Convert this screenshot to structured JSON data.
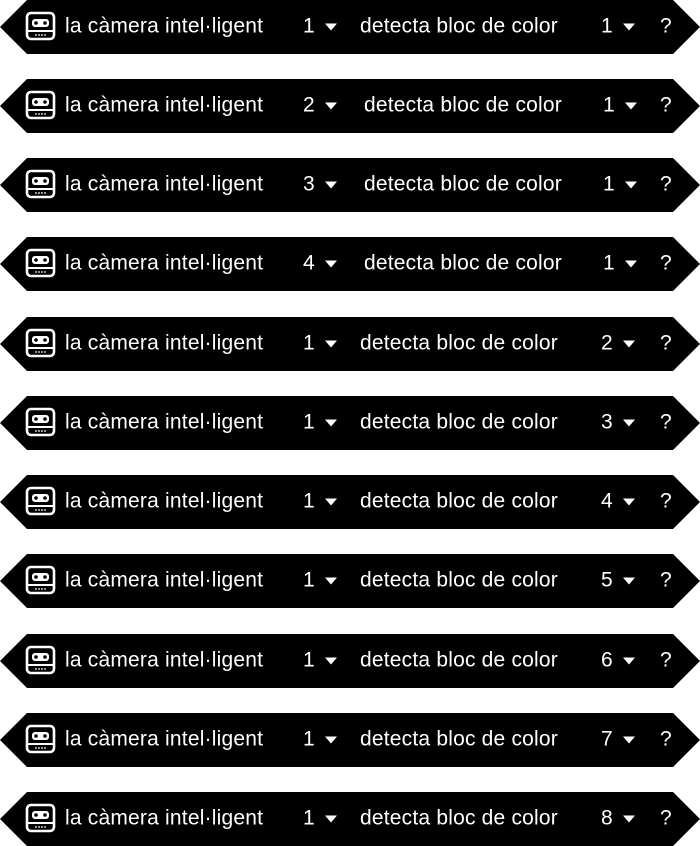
{
  "colors": {
    "block_bg": "#000000",
    "text": "#ffffff",
    "page_bg": "#ffffff"
  },
  "icon": "smart-camera-icon",
  "caret_icon": "caret-down-icon",
  "blocks": [
    {
      "camera_label": "la càmera intel·ligent",
      "camera_value": "1",
      "detect_label": "detecta bloc de color",
      "color_value": "1",
      "question": "?"
    },
    {
      "camera_label": "la càmera intel·ligent",
      "camera_value": "2",
      "detect_label": "detecta bloc de color",
      "color_value": "1",
      "question": "?"
    },
    {
      "camera_label": "la càmera intel·ligent",
      "camera_value": "3",
      "detect_label": "detecta bloc de color",
      "color_value": "1",
      "question": "?"
    },
    {
      "camera_label": "la càmera intel·ligent",
      "camera_value": "4",
      "detect_label": "detecta bloc de color",
      "color_value": "1",
      "question": "?"
    },
    {
      "camera_label": "la càmera intel·ligent",
      "camera_value": "1",
      "detect_label": "detecta bloc de color",
      "color_value": "2",
      "question": "?"
    },
    {
      "camera_label": "la càmera intel·ligent",
      "camera_value": "1",
      "detect_label": "detecta bloc de color",
      "color_value": "3",
      "question": "?"
    },
    {
      "camera_label": "la càmera intel·ligent",
      "camera_value": "1",
      "detect_label": "detecta bloc de color",
      "color_value": "4",
      "question": "?"
    },
    {
      "camera_label": "la càmera intel·ligent",
      "camera_value": "1",
      "detect_label": "detecta bloc de color",
      "color_value": "5",
      "question": "?"
    },
    {
      "camera_label": "la càmera intel·ligent",
      "camera_value": "1",
      "detect_label": "detecta bloc de color",
      "color_value": "6",
      "question": "?"
    },
    {
      "camera_label": "la càmera intel·ligent",
      "camera_value": "1",
      "detect_label": "detecta bloc de color",
      "color_value": "7",
      "question": "?"
    },
    {
      "camera_label": "la càmera intel·ligent",
      "camera_value": "1",
      "detect_label": "detecta bloc de color",
      "color_value": "8",
      "question": "?"
    }
  ]
}
